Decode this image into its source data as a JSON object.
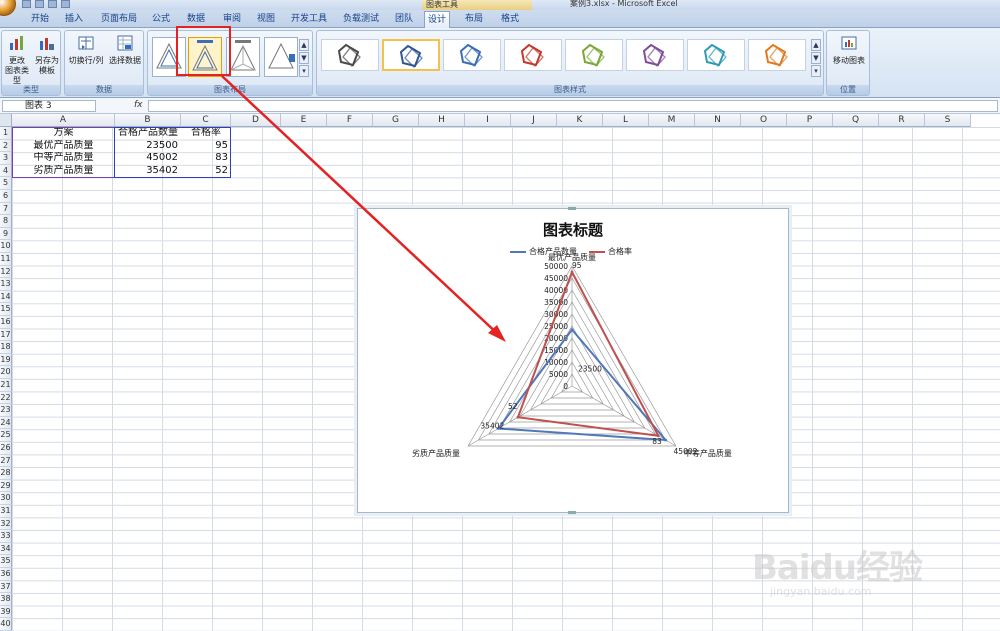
{
  "window": {
    "title": "案例3.xlsx - Microsoft Excel",
    "chart_tools_label": "图表工具"
  },
  "tabs": [
    "开始",
    "插入",
    "页面布局",
    "公式",
    "数据",
    "审阅",
    "视图",
    "开发工具",
    "负载测试",
    "团队",
    "设计",
    "布局",
    "格式"
  ],
  "active_tab": "设计",
  "ribbon": {
    "groups": {
      "type": "类型",
      "data": "数据",
      "chart_layouts": "图表布局",
      "chart_styles": "图表样式",
      "location": "位置"
    },
    "buttons": {
      "change_chart_type_1": "更改",
      "change_chart_type_2": "图表类型",
      "save_template_1": "另存为",
      "save_template_2": "模板",
      "switch_row_col": "切换行/列",
      "select_data": "选择数据",
      "move_chart": "移动图表"
    },
    "style_colors": [
      "#4a4a4a",
      "#2f5597",
      "#3b6db5",
      "#c0392b",
      "#7aa637",
      "#7d4d9c",
      "#2e9ab6",
      "#e07a1f"
    ]
  },
  "formula_bar": {
    "name_box": "图表 3",
    "fx": "fx",
    "value": ""
  },
  "columns": [
    "A",
    "B",
    "C",
    "D",
    "E",
    "F",
    "G",
    "H",
    "I",
    "J",
    "K",
    "L",
    "M",
    "N",
    "O",
    "P",
    "Q",
    "R",
    "S"
  ],
  "row_count": 40,
  "sheet": {
    "header": [
      "方案",
      "合格产品数量",
      "合格率"
    ],
    "rows": [
      [
        "最优产品质量",
        "23500",
        "95"
      ],
      [
        "中等产品质量",
        "45002",
        "83"
      ],
      [
        "劣质产品质量",
        "35402",
        "52"
      ]
    ]
  },
  "chart_data": {
    "type": "radar",
    "title": "图表标题",
    "categories": [
      "最优产品质量",
      "中等产品质量",
      "劣质产品质量"
    ],
    "series": [
      {
        "name": "合格产品数量",
        "values": [
          23500,
          45002,
          35402
        ],
        "color": "#4f78b8"
      },
      {
        "name": "合格率",
        "values": [
          95,
          83,
          52
        ],
        "color": "#c0504d"
      }
    ],
    "axis_max": 50000,
    "axis_ticks": [
      "0",
      "5000",
      "10000",
      "15000",
      "20000",
      "25000",
      "30000",
      "35000",
      "40000",
      "45000",
      "50000"
    ],
    "data_labels": [
      "23500",
      "45002",
      "35402",
      "95",
      "83",
      "52"
    ],
    "legend_position": "top"
  },
  "watermark": {
    "logo": "Baidu经验",
    "url": "jingyan.baidu.com"
  }
}
